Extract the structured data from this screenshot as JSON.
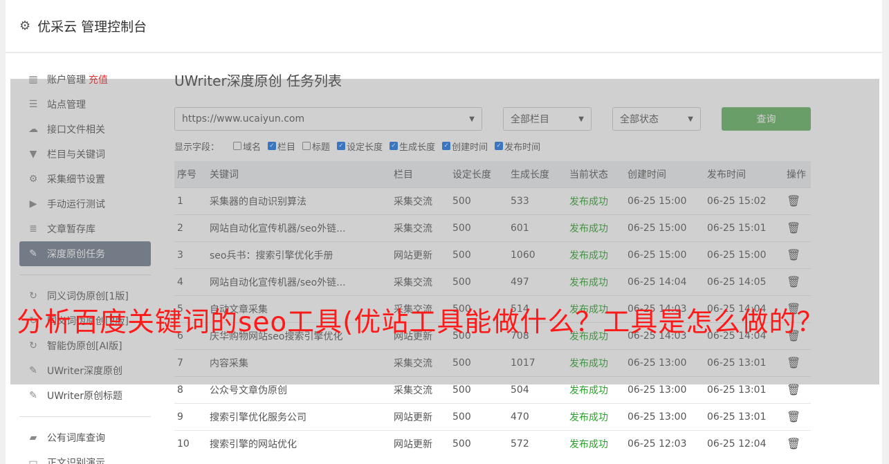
{
  "app": {
    "title": "优采云 管理控制台"
  },
  "sidebar": {
    "items": [
      {
        "label": "账户管理",
        "extra": "充值",
        "icon": "bar-chart-icon"
      },
      {
        "label": "站点管理",
        "icon": "server-icon"
      },
      {
        "label": "接口文件相关",
        "icon": "cloud-upload-icon"
      },
      {
        "label": "栏目与关键词",
        "icon": "filter-icon"
      },
      {
        "label": "采集细节设置",
        "icon": "gears-icon"
      },
      {
        "label": "手动运行测试",
        "icon": "play-circle-icon"
      },
      {
        "label": "文章暂存库",
        "icon": "database-icon"
      },
      {
        "label": "深度原创任务",
        "icon": "edit-icon",
        "active": true
      },
      {
        "label": "同义词伪原创[1版]",
        "icon": "refresh-icon"
      },
      {
        "label": "同义词伪原创[2版]",
        "icon": "refresh-icon"
      },
      {
        "label": "智能伪原创[AI版]",
        "icon": "refresh-icon"
      },
      {
        "label": "UWriter深度原创",
        "icon": "edit-icon"
      },
      {
        "label": "UWriter原创标题",
        "icon": "edit-icon"
      },
      {
        "label": "公有词库查询",
        "icon": "book-icon"
      },
      {
        "label": "正文识别演示",
        "icon": "monitor-icon"
      }
    ]
  },
  "main": {
    "title": "UWriter深度原创 任务列表",
    "site_select": "https://www.ucaiyun.com",
    "column_select": "全部栏目",
    "status_select": "全部状态",
    "query_label": "查询",
    "fields_label": "显示字段：",
    "fields": [
      {
        "label": "域名",
        "checked": false
      },
      {
        "label": "栏目",
        "checked": true
      },
      {
        "label": "标题",
        "checked": false
      },
      {
        "label": "设定长度",
        "checked": true
      },
      {
        "label": "生成长度",
        "checked": true
      },
      {
        "label": "创建时间",
        "checked": true
      },
      {
        "label": "发布时间",
        "checked": true
      }
    ],
    "columns": [
      "序号",
      "关键词",
      "栏目",
      "设定长度",
      "生成长度",
      "当前状态",
      "创建时间",
      "发布时间",
      "操作"
    ],
    "rows": [
      [
        "1",
        "采集器的自动识别算法",
        "采集交流",
        "500",
        "533",
        "发布成功",
        "06-25 15:00",
        "06-25 15:02"
      ],
      [
        "2",
        "网站自动化宣传机器/seo外链...",
        "采集交流",
        "500",
        "601",
        "发布成功",
        "06-25 15:00",
        "06-25 15:01"
      ],
      [
        "3",
        "seo兵书：搜索引擎优化手册",
        "网站更新",
        "500",
        "1060",
        "发布成功",
        "06-25 15:00",
        "06-25 15:00"
      ],
      [
        "4",
        "网站自动化宣传机器/seo外链...",
        "采集交流",
        "500",
        "497",
        "发布成功",
        "06-25 14:04",
        "06-25 14:05"
      ],
      [
        "5",
        "自动文章采集",
        "采集交流",
        "500",
        "514",
        "发布成功",
        "06-25 14:03",
        "06-25 14:04"
      ],
      [
        "6",
        "庆华购物网站seo搜索引擎优化",
        "网站更新",
        "500",
        "708",
        "发布成功",
        "06-25 14:03",
        "06-25 14:04"
      ],
      [
        "7",
        "内容采集",
        "采集交流",
        "500",
        "1017",
        "发布成功",
        "06-25 13:00",
        "06-25 13:01"
      ],
      [
        "8",
        "公众号文章伪原创",
        "采集交流",
        "500",
        "504",
        "发布成功",
        "06-25 13:00",
        "06-25 13:01"
      ],
      [
        "9",
        "搜索引擎优化服务公司",
        "网站更新",
        "500",
        "470",
        "发布成功",
        "06-25 13:00",
        "06-25 13:01"
      ],
      [
        "10",
        "搜索引擎的网站优化",
        "网站更新",
        "500",
        "572",
        "发布成功",
        "06-25 12:03",
        "06-25 12:04"
      ]
    ]
  },
  "banner": {
    "text": "分析百度关键词的seo工具(优站工具能做什么？工具是怎么做的？"
  }
}
